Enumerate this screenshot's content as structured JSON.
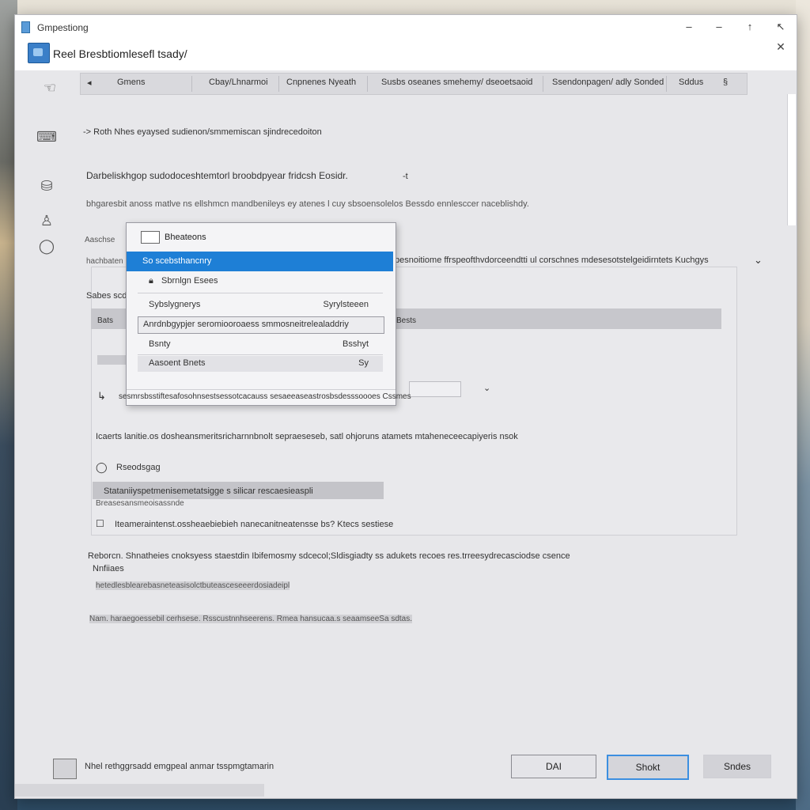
{
  "window": {
    "title": "Gmpestiong",
    "subtitle": "Reel Bresbtiomlesefl tsady/",
    "controls": {
      "minimize": "–",
      "restore": "–",
      "maximize": "↑",
      "close": "↖",
      "extra": "✕"
    }
  },
  "rail": [
    {
      "name": "gesture",
      "glyph": "☜"
    },
    {
      "name": "device",
      "glyph": "⌨"
    },
    {
      "name": "disk",
      "glyph": "⛁"
    },
    {
      "name": "person",
      "glyph": "♙"
    },
    {
      "name": "shield",
      "glyph": "◯"
    }
  ],
  "tabs": [
    {
      "label": "Gmens"
    },
    {
      "label": "Cbay/Lhnarmoi"
    },
    {
      "label": "Cnpnenes Nyeath"
    },
    {
      "label": "Susbs oseanes smehemy/ dseoetsaoid"
    },
    {
      "label": "Ssendonpagen/ adly Sonded"
    },
    {
      "label": "Sddus"
    }
  ],
  "content": {
    "breadcrumb": "-> Roth Nhes eyaysed sudienon/smmemiscan sjindrecedoiton",
    "heading": "Darbeliskhgop sudodoceshtemtorl broobdpyear fridcsh Eosidr.",
    "heading_marker": "-t",
    "desc_line": "bhgaresbit anoss matlve ns ellshmcn  mandbenileys ey atenes l cuy sbsoensolelos Bessdo ennlesccer naceblishdy.",
    "label_left_1": "Aaschse",
    "label_left_2": "hachbaten",
    "long_right": "pesnoitiome ffrspeofthvdorceendtti ul corschnes mdesesotstelgeidirntets Kuchgys",
    "section_label": "Sabes scd",
    "bullet_line": "Icaerts lanitie.os dosheansmeritsricharnnbnolt sepraeseseb, satl ohjoruns atamets mtaheneceecapiyeris nsok",
    "radio_label": "Rseodsgag",
    "selected_bar": "Stataniiyspetmenisemetatsigge s silicar rescaesieaspli",
    "sub_caption": "Breasesansmeoisassnde",
    "checkbox_line": "Iteameraintenst.ossheaebiebieh nanecanitneatensse bs? Ktecs sestiese",
    "para_1": "Reborcn. Shnatheies cnoksyess staestdin Ibifemosmy sdcecol;Sldisgiadty ss adukets recoes res.trreesydrecasciodse csence",
    "para_2": "Nnfiiaes",
    "blur_1": "hetedlesblearebasneteasisolctbuteasceseeerdosiadeipl",
    "blur_2": "Nam. haraegoessebil cerhsese. Rsscustnnhseerens. Rmea hansucaa.s  seaamseeSa sdtas."
  },
  "dropdown": {
    "header": "Bheateons",
    "selected": "So scebsthancnry",
    "item_2": "Sbrnlgn Esees",
    "row_1": {
      "left": "Sybslygnerys",
      "right": "Syrylsteeen"
    },
    "row_2_full": "Anrdnbgypjer seromiooroaess smmosneitrelealaddriy",
    "row_3": {
      "left": "Bsnty",
      "right": "Bsshyt"
    },
    "row_4": {
      "left": "Aasoent Bnets",
      "right": "Sy"
    },
    "footer": "sesmrsbsstiftesafosohnsestsessotcacauss sesaeeaseastrosbsdesssoooes Cssmes"
  },
  "panel_row": {
    "left": "Bats",
    "right": "Bests"
  },
  "footer": {
    "text": "Nhel rethggrsadd emgpeal anmar tsspmgtamarin",
    "ok_label": "DAI",
    "primary_label": "Shokt",
    "cancel_label": "Sndes"
  }
}
